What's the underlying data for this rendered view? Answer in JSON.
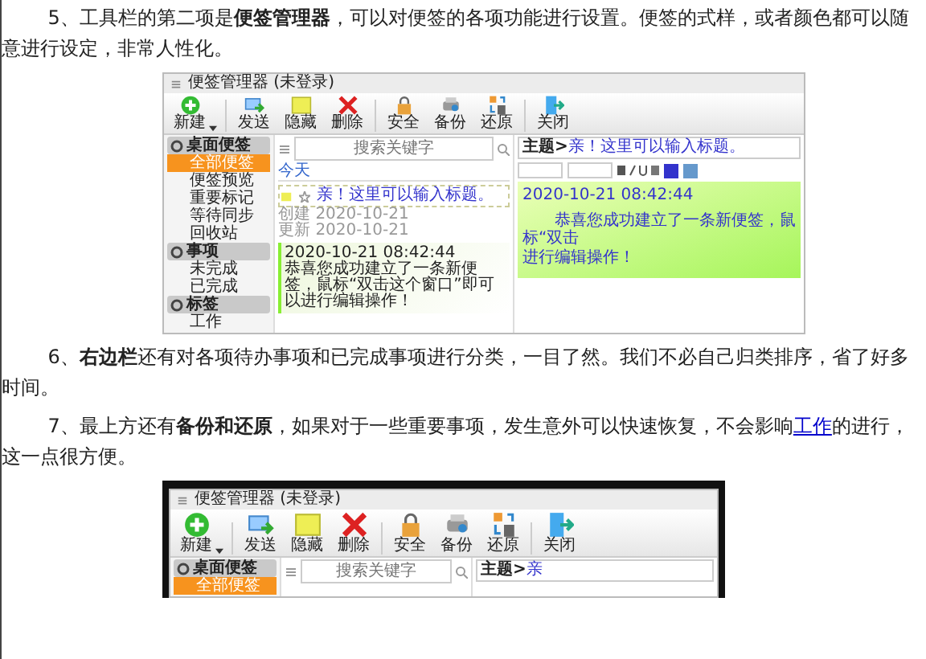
{
  "article": [
    {
      "kind": "paragraph",
      "segments": [
        {
          "kind": "text",
          "text": "5、工具栏的第二项是**便签管理器**，可以对便签的各项功能进行设置。便签的式样，或者颜色都可以随意进行设定，非常人性化。"
        }
      ]
    },
    {
      "kind": "screenshot",
      "window": {
        "title": "便签管理器 (未登录)",
        "toolbar": [
          {
            "kind": "new",
            "label": "新建"
          },
          {
            "kind": "send",
            "label": "发送"
          },
          {
            "kind": "hide",
            "label": "隐藏"
          },
          {
            "kind": "delete",
            "label": "删除"
          },
          {
            "kind": "security",
            "label": "安全"
          },
          {
            "kind": "backup",
            "label": "备份"
          },
          {
            "kind": "restore",
            "label": "还原"
          },
          {
            "kind": "close",
            "label": "关闭"
          }
        ],
        "sidebar": [
          {
            "label": "桌面便签",
            "items": [
              {
                "label": "全部便签",
                "selected": true
              },
              {
                "label": "便签预览",
                "selected": false
              },
              {
                "label": "重要标记",
                "selected": false
              },
              {
                "label": "等待同步",
                "selected": false
              },
              {
                "label": "回收站",
                "selected": false
              }
            ]
          },
          {
            "label": "事项",
            "items": [
              {
                "label": "未完成",
                "selected": false
              },
              {
                "label": "已完成",
                "selected": false
              }
            ]
          },
          {
            "label": "标签",
            "items": [
              {
                "label": "工作",
                "selected": false
              }
            ]
          }
        ],
        "search": {
          "placeholder": "搜索关键字"
        },
        "note_list": {
          "group": "今天",
          "notes": [
            {
              "title": "亲！这里可以输入标题。",
              "created_label": "创建",
              "created": "2020-10-21",
              "updated_label": "更新",
              "updated": "2020-10-21",
              "time": "2020-10-21 08:42:44",
              "body": "恭喜您成功建立了一条新便签，鼠标“双击这个窗口”即可以进行编辑操作！"
            }
          ]
        },
        "editor": {
          "subject_label": "主题>",
          "subject": "亲！这里可以输入标题。",
          "time": "2020-10-21 08:42:44",
          "lines": [
            "恭喜您成功建立了一条新便签，鼠标“双击",
            "进行编辑操作！"
          ]
        }
      }
    },
    {
      "kind": "paragraph",
      "segments": [
        {
          "kind": "text",
          "text": "6、**右边栏**还有对各项待办事项和已完成事项进行分类，一目了然。我们不必自己归类排序，省了好多时间。"
        }
      ]
    },
    {
      "kind": "paragraph",
      "segments": [
        {
          "kind": "text",
          "text": "7、最上方还有**备份和还原**，如果对于一些重要事项，发生意外可以快速恢复，不会影响"
        },
        {
          "kind": "link",
          "text": "工作"
        },
        {
          "kind": "text",
          "text": "的进行，这一点很方便。"
        }
      ]
    },
    {
      "kind": "screenshot",
      "window": {
        "title": "便签管理器 (未登录)",
        "toolbar": [
          {
            "kind": "new",
            "label": "新建"
          },
          {
            "kind": "send",
            "label": "发送"
          },
          {
            "kind": "hide",
            "label": "隐藏"
          },
          {
            "kind": "delete",
            "label": "删除"
          },
          {
            "kind": "security",
            "label": "安全"
          },
          {
            "kind": "backup",
            "label": "备份"
          },
          {
            "kind": "restore",
            "label": "还原"
          },
          {
            "kind": "close",
            "label": "关闭"
          }
        ],
        "sidebar": [
          {
            "label": "桌面便签",
            "items": [
              {
                "label": "全部便签",
                "selected": true
              }
            ]
          }
        ],
        "search": {
          "placeholder": "搜索关键字"
        },
        "editor": {
          "subject_label": "主题>",
          "subject": "亲"
        }
      }
    }
  ]
}
